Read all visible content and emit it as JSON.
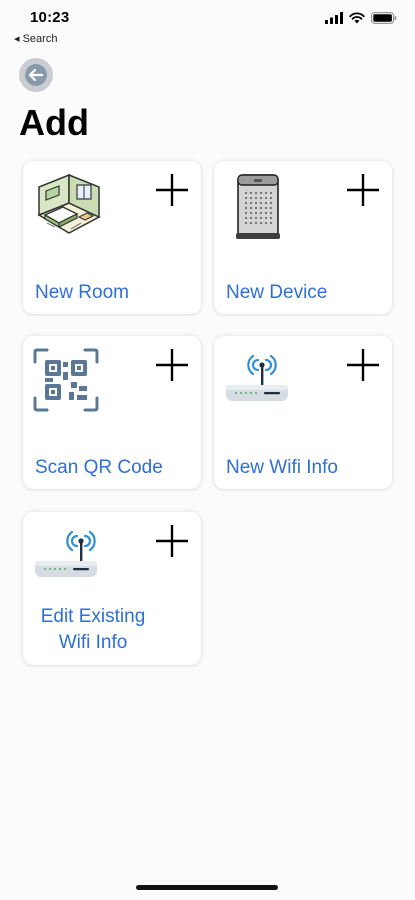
{
  "status_bar": {
    "time": "10:23",
    "back_label": "◂ Search",
    "icons": [
      "signal-icon",
      "wifi-icon",
      "battery-icon"
    ]
  },
  "header": {
    "back_icon": "arrow-left-icon",
    "title": "Add"
  },
  "cards": [
    {
      "label": "New Room",
      "icon": "room-icon"
    },
    {
      "label": "New Device",
      "icon": "air-purifier-icon"
    },
    {
      "label": "Scan QR Code",
      "icon": "qr-code-icon"
    },
    {
      "label": "New Wifi Info",
      "icon": "router-icon"
    },
    {
      "label_line1": "Edit Existing",
      "label_line2": "Wifi Info",
      "icon": "router-icon"
    }
  ],
  "colors": {
    "accent": "#2f6fd6",
    "background": "#fbfbfb",
    "card": "#ffffff"
  }
}
